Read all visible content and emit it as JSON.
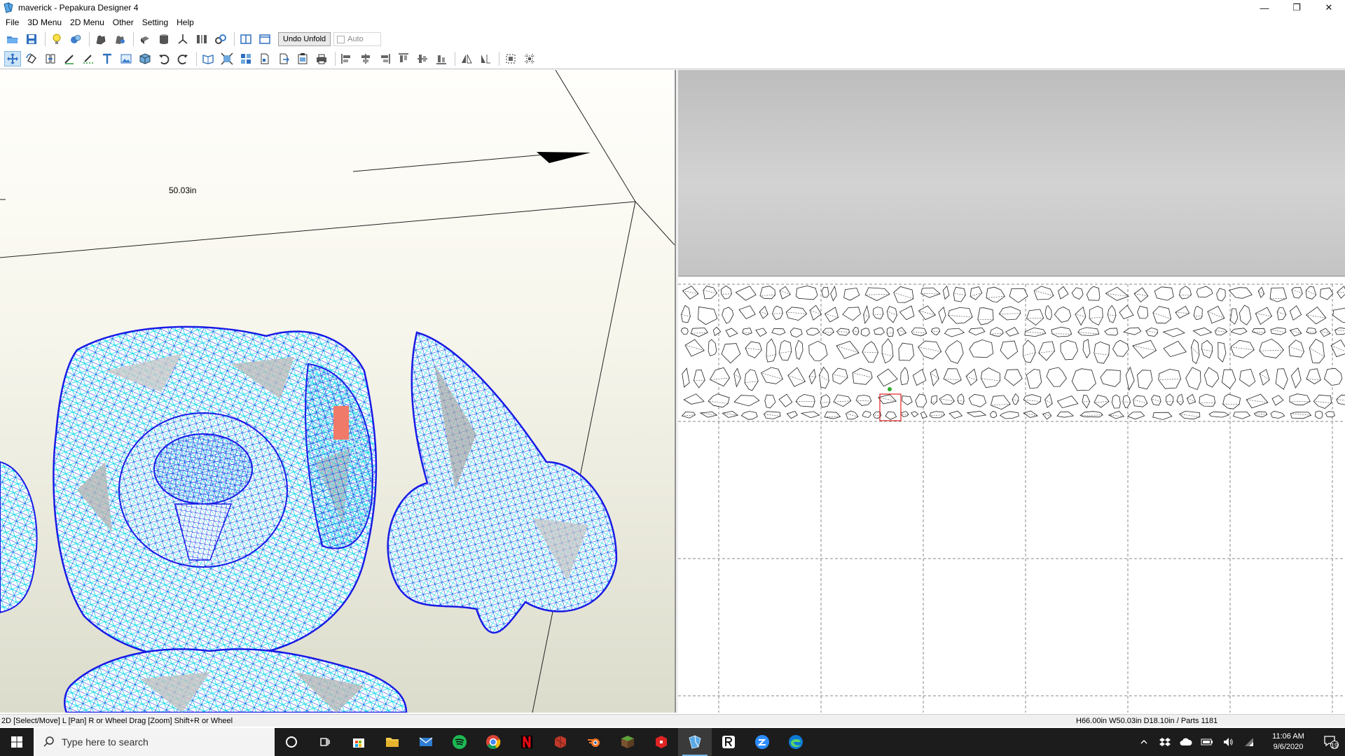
{
  "window": {
    "title": "maverick - Pepakura Designer 4",
    "controls": {
      "minimize": "—",
      "maximize": "❐",
      "close": "✕"
    }
  },
  "menu": [
    "File",
    "3D Menu",
    "2D Menu",
    "Other",
    "Setting",
    "Help"
  ],
  "toolbar1": {
    "undo_unfold": "Undo Unfold",
    "auto_label": "Auto"
  },
  "view3d": {
    "dimension_label": "50.03in",
    "colors": {
      "mesh_blue": "#1a1ae6",
      "mesh_cyan": "#22d6e8",
      "selected_face": "#f07a6a"
    }
  },
  "statusbar": {
    "left": "2D [Select/Move] L [Pan] R or Wheel Drag [Zoom] Shift+R or Wheel",
    "right": "H66.00in W50.03in D18.10in / Parts 1181"
  },
  "taskbar": {
    "search_placeholder": "Type here to search",
    "apps": [
      "cortana-icon",
      "task-view-icon",
      "store-icon",
      "file-explorer-icon",
      "mail-icon",
      "spotify-icon",
      "chrome-icon",
      "netflix-icon",
      "app-icon",
      "blender-icon",
      "minecraft-icon",
      "roblox-icon",
      "pepakura-icon",
      "roblox-studio-icon",
      "zoom-icon",
      "edge-icon"
    ],
    "time": "11:06 AM",
    "date": "9/6/2020",
    "notification_count": "19"
  }
}
